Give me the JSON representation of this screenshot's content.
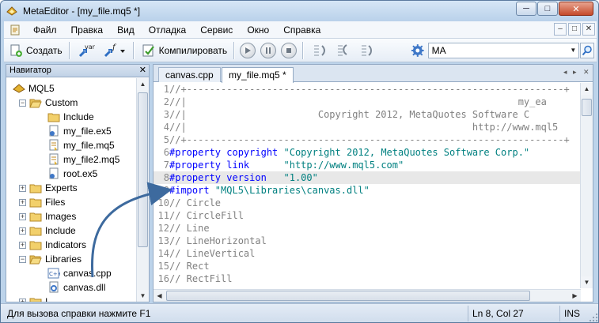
{
  "window": {
    "title": "MetaEditor - [my_file.mq5 *]",
    "minimize": "─",
    "maximize": "□",
    "close": "✕"
  },
  "menu": {
    "items": [
      "Файл",
      "Правка",
      "Вид",
      "Отладка",
      "Сервис",
      "Окно",
      "Справка"
    ],
    "mdi": [
      "–",
      "□",
      "✕"
    ]
  },
  "toolbar": {
    "create_label": "Создать",
    "var_label": "var",
    "func_label": "f",
    "compile_label": "Компилировать",
    "search_value": "MA"
  },
  "navigator": {
    "title": "Навигатор",
    "close": "✕",
    "tree": [
      {
        "label": "MQL5",
        "icon": "mql5-folder-icon",
        "expander": "",
        "level": 0
      },
      {
        "label": "Custom",
        "icon": "folder-open-icon",
        "expander": "−",
        "level": 1
      },
      {
        "label": "Include",
        "icon": "folder-icon",
        "expander": "",
        "level": 2
      },
      {
        "label": "my_file.ex5",
        "icon": "ex5-file-icon",
        "expander": "",
        "level": 2
      },
      {
        "label": "my_file.mq5",
        "icon": "mq5-file-icon",
        "expander": "",
        "level": 2
      },
      {
        "label": "my_file2.mq5",
        "icon": "mq5-file-icon",
        "expander": "",
        "level": 2
      },
      {
        "label": "root.ex5",
        "icon": "ex5-file-icon",
        "expander": "",
        "level": 2
      },
      {
        "label": "Experts",
        "icon": "folder-icon",
        "expander": "+",
        "level": 1
      },
      {
        "label": "Files",
        "icon": "folder-icon",
        "expander": "+",
        "level": 1
      },
      {
        "label": "Images",
        "icon": "folder-icon",
        "expander": "+",
        "level": 1
      },
      {
        "label": "Include",
        "icon": "folder-icon",
        "expander": "+",
        "level": 1
      },
      {
        "label": "Indicators",
        "icon": "folder-icon",
        "expander": "+",
        "level": 1
      },
      {
        "label": "Libraries",
        "icon": "folder-open-icon",
        "expander": "−",
        "level": 1
      },
      {
        "label": "canvas.cpp",
        "icon": "cpp-file-icon",
        "expander": "",
        "level": 2
      },
      {
        "label": "canvas.dll",
        "icon": "dll-file-icon",
        "expander": "",
        "level": 2
      },
      {
        "label": "I",
        "icon": "folder-icon",
        "expander": "+",
        "level": 1
      }
    ]
  },
  "editor": {
    "tabs": [
      "canvas.cpp",
      "my_file.mq5 *"
    ],
    "active_tab": 1,
    "tab_nav": [
      "◂",
      "▸",
      "✕"
    ],
    "highlight_line": 8,
    "lines": [
      {
        "n": "1",
        "parts": [
          {
            "t": "//+------------------------------------------------------------------+",
            "c": "cmt"
          }
        ]
      },
      {
        "n": "2",
        "parts": [
          {
            "t": "//|                                                          my_ea",
            "c": "cmt"
          }
        ]
      },
      {
        "n": "3",
        "parts": [
          {
            "t": "//|                       Copyright 2012, MetaQuotes Software C",
            "c": "cmt"
          }
        ]
      },
      {
        "n": "4",
        "parts": [
          {
            "t": "//|                                                  http://www.mql5",
            "c": "cmt"
          }
        ]
      },
      {
        "n": "5",
        "parts": [
          {
            "t": "//+------------------------------------------------------------------+",
            "c": "cmt"
          }
        ]
      },
      {
        "n": "6",
        "parts": [
          {
            "t": "#property copyright ",
            "c": "kw"
          },
          {
            "t": "\"Copyright 2012, MetaQuotes Software Corp.\"",
            "c": "str"
          }
        ]
      },
      {
        "n": "7",
        "parts": [
          {
            "t": "#property link      ",
            "c": "kw"
          },
          {
            "t": "\"http://www.mql5.com\"",
            "c": "str"
          }
        ]
      },
      {
        "n": "8",
        "parts": [
          {
            "t": "#property version   ",
            "c": "kw"
          },
          {
            "t": "\"1.00\"",
            "c": "str"
          }
        ]
      },
      {
        "n": "9",
        "parts": [
          {
            "t": "#import ",
            "c": "kw"
          },
          {
            "t": "\"MQL5\\Libraries\\canvas.dll\"",
            "c": "str"
          }
        ]
      },
      {
        "n": "10",
        "parts": [
          {
            "t": "// Circle",
            "c": "cmt"
          }
        ]
      },
      {
        "n": "11",
        "parts": [
          {
            "t": "// CircleFill",
            "c": "cmt"
          }
        ]
      },
      {
        "n": "12",
        "parts": [
          {
            "t": "// Line",
            "c": "cmt"
          }
        ]
      },
      {
        "n": "13",
        "parts": [
          {
            "t": "// LineHorizontal",
            "c": "cmt"
          }
        ]
      },
      {
        "n": "14",
        "parts": [
          {
            "t": "// LineVertical",
            "c": "cmt"
          }
        ]
      },
      {
        "n": "15",
        "parts": [
          {
            "t": "// Rect",
            "c": "cmt"
          }
        ]
      },
      {
        "n": "16",
        "parts": [
          {
            "t": "// RectFill",
            "c": "cmt"
          }
        ]
      }
    ]
  },
  "status": {
    "help_text": "Для вызова справки нажмите F1",
    "position": "Ln 8, Col 27",
    "mode": "INS"
  },
  "colors": {
    "keyword": "#0000ff",
    "string": "#008080",
    "comment": "#808080",
    "arrow": "#3d6a9e"
  }
}
